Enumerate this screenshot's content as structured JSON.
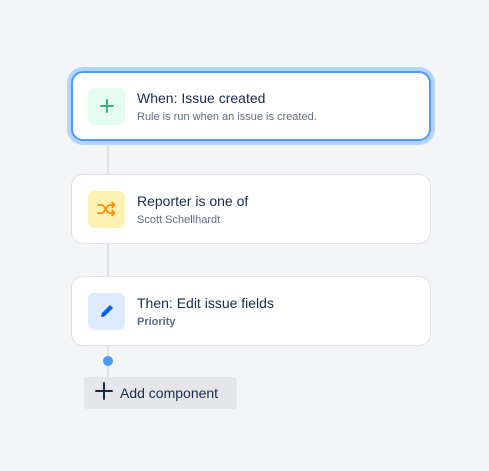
{
  "flow": {
    "trigger": {
      "title": "When: Issue created",
      "subtitle": "Rule is run when an issue is created.",
      "icon": "plus-icon",
      "color": "#36b37e"
    },
    "condition": {
      "title": "Reporter is one of",
      "subtitle": "Scott Schellhardt",
      "icon": "shuffle-icon",
      "color": "#ff8b00"
    },
    "action": {
      "title": "Then: Edit issue fields",
      "subtitle": "Priority",
      "icon": "pencil-icon",
      "color": "#0065ff"
    }
  },
  "add_component": {
    "label": "Add component",
    "icon": "plus-icon"
  },
  "colors": {
    "selected_border": "#4c9aff",
    "connector": "#dfe1e6"
  }
}
